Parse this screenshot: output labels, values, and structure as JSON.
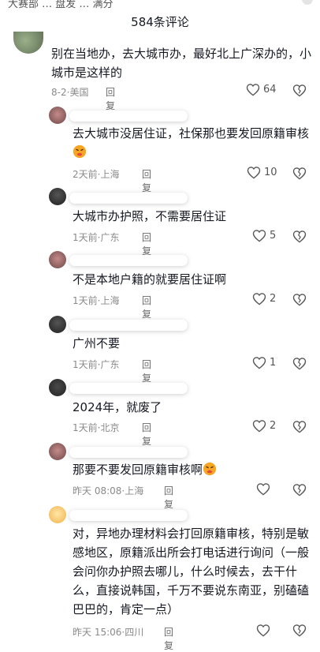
{
  "top_partial": {
    "text": "大赛部 … 盘发 … 满分"
  },
  "header": {
    "title": "584条评论"
  },
  "comments": [
    {
      "text": "别在当地办，去大城市办，最好北上广深办的，小城市是这样的",
      "date": "8-2",
      "location": "美国",
      "reply_label": "回复",
      "likes": "64"
    },
    {
      "text": "去大城市没居住证，社保那也要发回原籍审核",
      "date": "2天前",
      "location": "上海",
      "reply_label": "回复",
      "likes": "10"
    },
    {
      "text": "大城市办护照，不需要居住证",
      "date": "1天前",
      "location": "广东",
      "reply_label": "回复",
      "likes": "5"
    },
    {
      "text": "不是本地户籍的就要居住证啊",
      "date": "1天前",
      "location": "上海",
      "reply_label": "回复",
      "likes": "2"
    },
    {
      "text": "广州不要",
      "date": "1天前",
      "location": "广东",
      "reply_label": "回复",
      "likes": "1"
    },
    {
      "text": "2024年，就废了",
      "date": "1天前",
      "location": "北京",
      "reply_label": "回复",
      "likes": "2"
    },
    {
      "text": "那要不要发回原籍审核啊",
      "date": "昨天 08:08",
      "location": "上海",
      "reply_label": "回复",
      "likes": ""
    },
    {
      "text": "对，异地办理材料会打回原籍审核，特别是敏感地区，原籍派出所会打电话进行询问（一般会问你办护照去哪儿，什么时候去，去干什么，直接说韩国，千万不要说东南亚，别磕磕巴巴的，肯定一点）",
      "date": "昨天 15:06",
      "location": "四川",
      "reply_label": "回复",
      "likes": ""
    }
  ],
  "icons": {
    "like": "heart-outline-icon",
    "dislike": "broken-heart-icon",
    "emoji": "angry-face-emoji"
  },
  "colors": {
    "text": "#161823",
    "meta": "#8a8a8a",
    "emoji_face": "#f5a623",
    "emoji_angry": "#e8463a"
  }
}
